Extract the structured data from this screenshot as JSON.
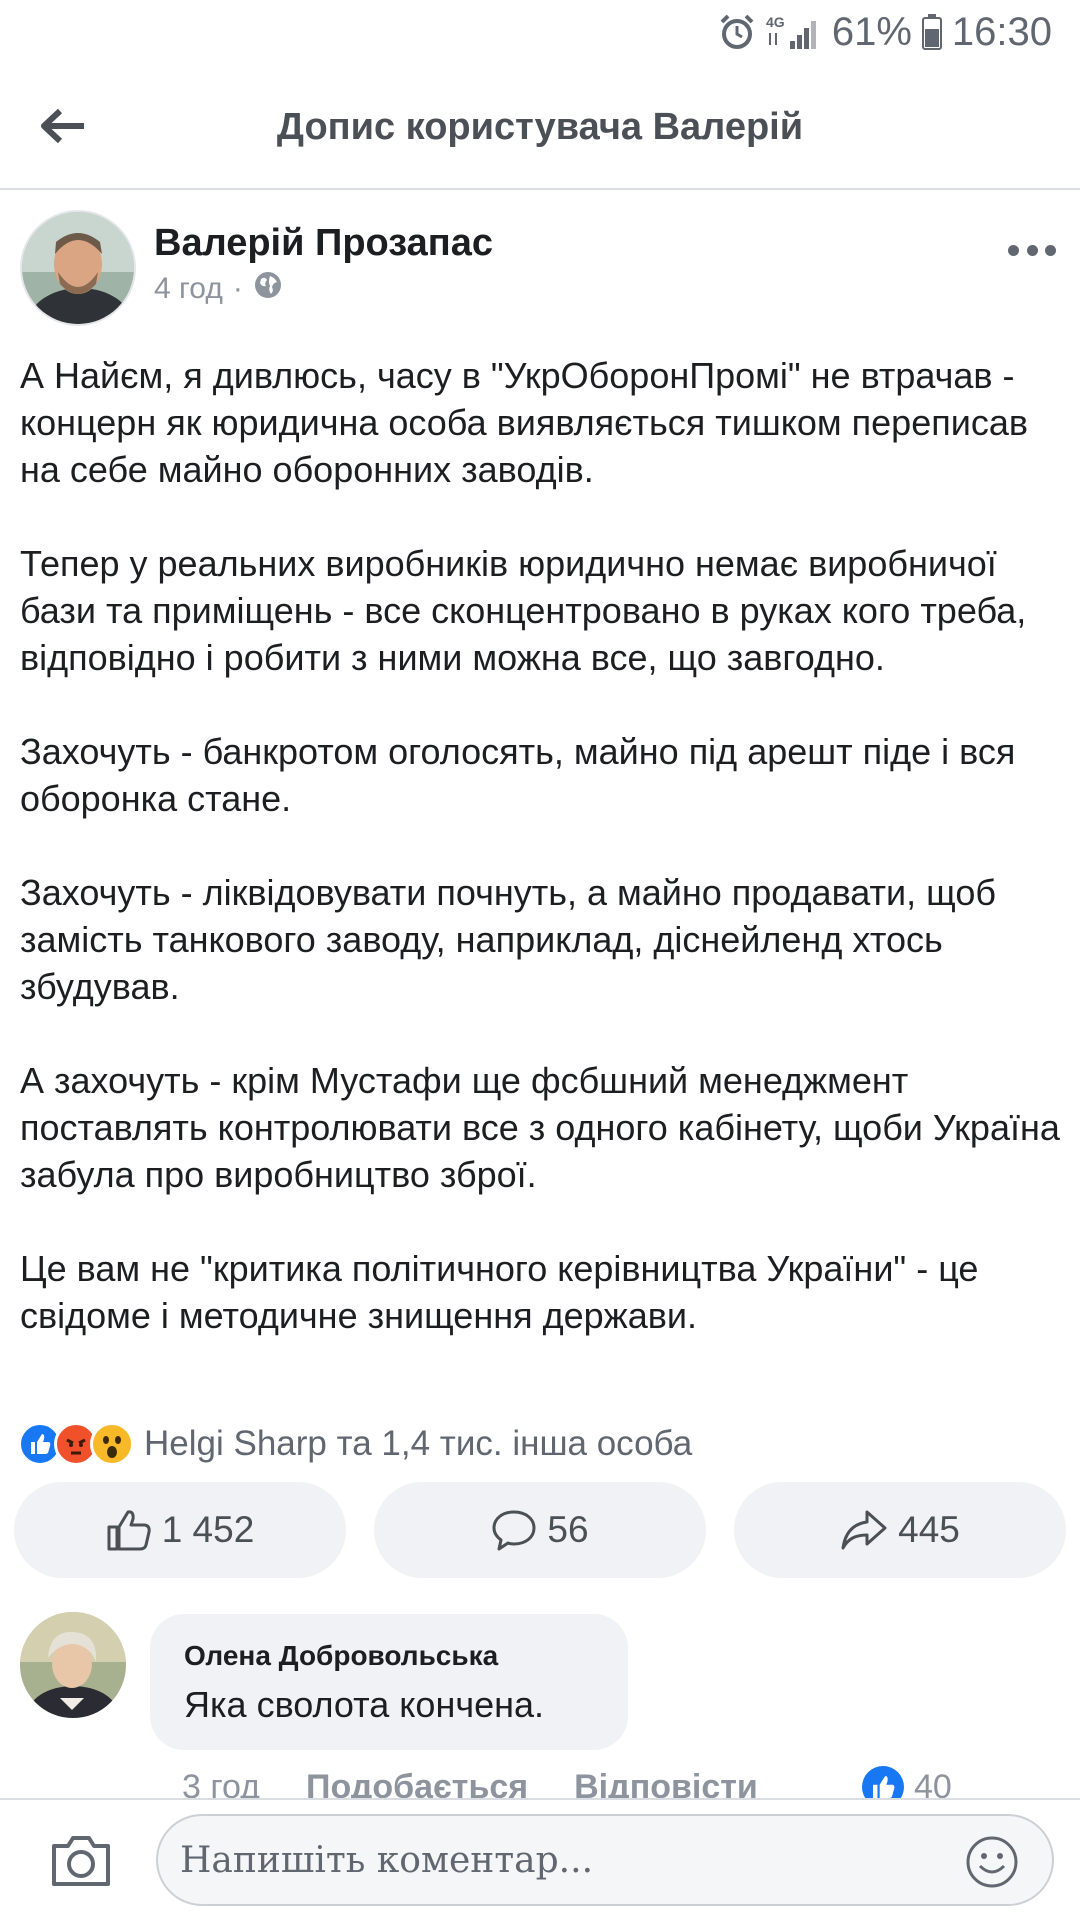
{
  "status_bar": {
    "network": "4G",
    "battery": "61%",
    "time": "16:30"
  },
  "header": {
    "title": "Допис користувача Валерій"
  },
  "post": {
    "author": "Валерій Прозапас",
    "time": "4 год",
    "separator": "·",
    "paragraphs": [
      "А Найєм, я дивлюсь, часу в \"УкрОборонПромі\" не втрачав -  концерн як юридична особа виявляється тишком переписав на себе майно оборонних заводів.",
      "Тепер у реальних виробників юридично немає виробничої бази та приміщень - все сконцентровано в руках кого треба, відповідно і робити з ними можна все, що завгодно.",
      "Захочуть - банкротом оголосять, майно під арешт піде і вся оборонка стане.",
      "Захочуть - ліквідовувати почнуть, а майно продавати, щоб замість танкового заводу, наприклад, діснейленд хтось збудував.",
      "А захочуть - крім Мустафи ще фсбшний менеджмент поставлять контролювати все з одного кабінету, щоби Україна забула про виробництво зброї.",
      "Це вам не \"критика політичного керівництва України\" - це свідоме і методичне знищення держави."
    ],
    "reactions_summary": "Helgi Sharp та 1,4 тис. інша особа",
    "actions": {
      "like_count": "1 452",
      "comment_count": "56",
      "share_count": "445"
    }
  },
  "comment": {
    "author": "Олена Добровольська",
    "text": "Яка сволота кончена.",
    "time": "3 год",
    "like_label": "Подобається",
    "reply_label": "Відповісти",
    "like_count": "40"
  },
  "composer": {
    "placeholder": "Напишіть коментар..."
  },
  "colors": {
    "like_blue": "#1877f2",
    "angry": "#f0512a",
    "wow_yellow": "#f7b928",
    "muted_text": "#606770",
    "button_bg": "#f0f2f5"
  }
}
